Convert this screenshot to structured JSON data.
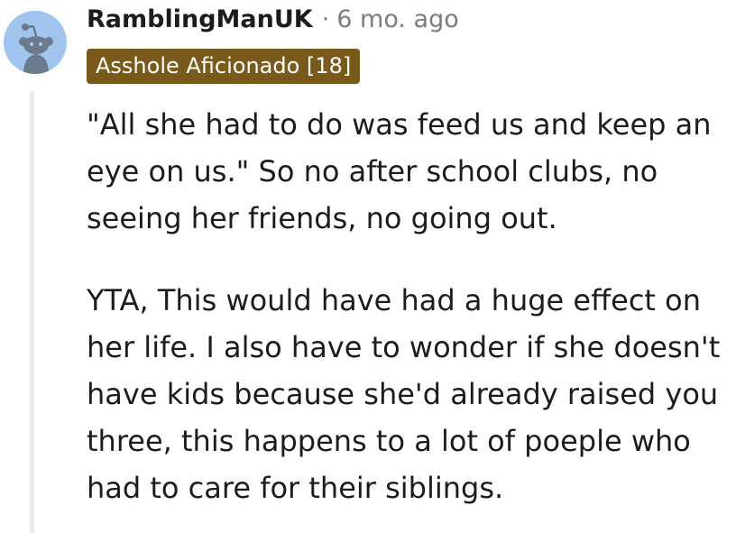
{
  "comment": {
    "username": "RamblingManUK",
    "separator": "·",
    "timestamp": "6 mo. ago",
    "flair": "Asshole Aficionado [18]",
    "paragraphs": [
      "\"All she had to do was feed us and keep an eye on us.\" So no after school clubs, no seeing her friends, no going out.",
      "YTA, This would have had a huge effect on her life. I also have to wonder if she doesn't have kids because she'd already raised you three, this happens to a lot of poeple who had to care for their siblings."
    ]
  },
  "colors": {
    "avatar_bg": "#9fc5ef",
    "flair_bg": "#7a5a1a",
    "flair_text": "#ffffff",
    "meta_text": "#7c7c7c",
    "thread_line": "#ececec"
  },
  "icons": {
    "avatar": "snoo-avatar-icon"
  }
}
